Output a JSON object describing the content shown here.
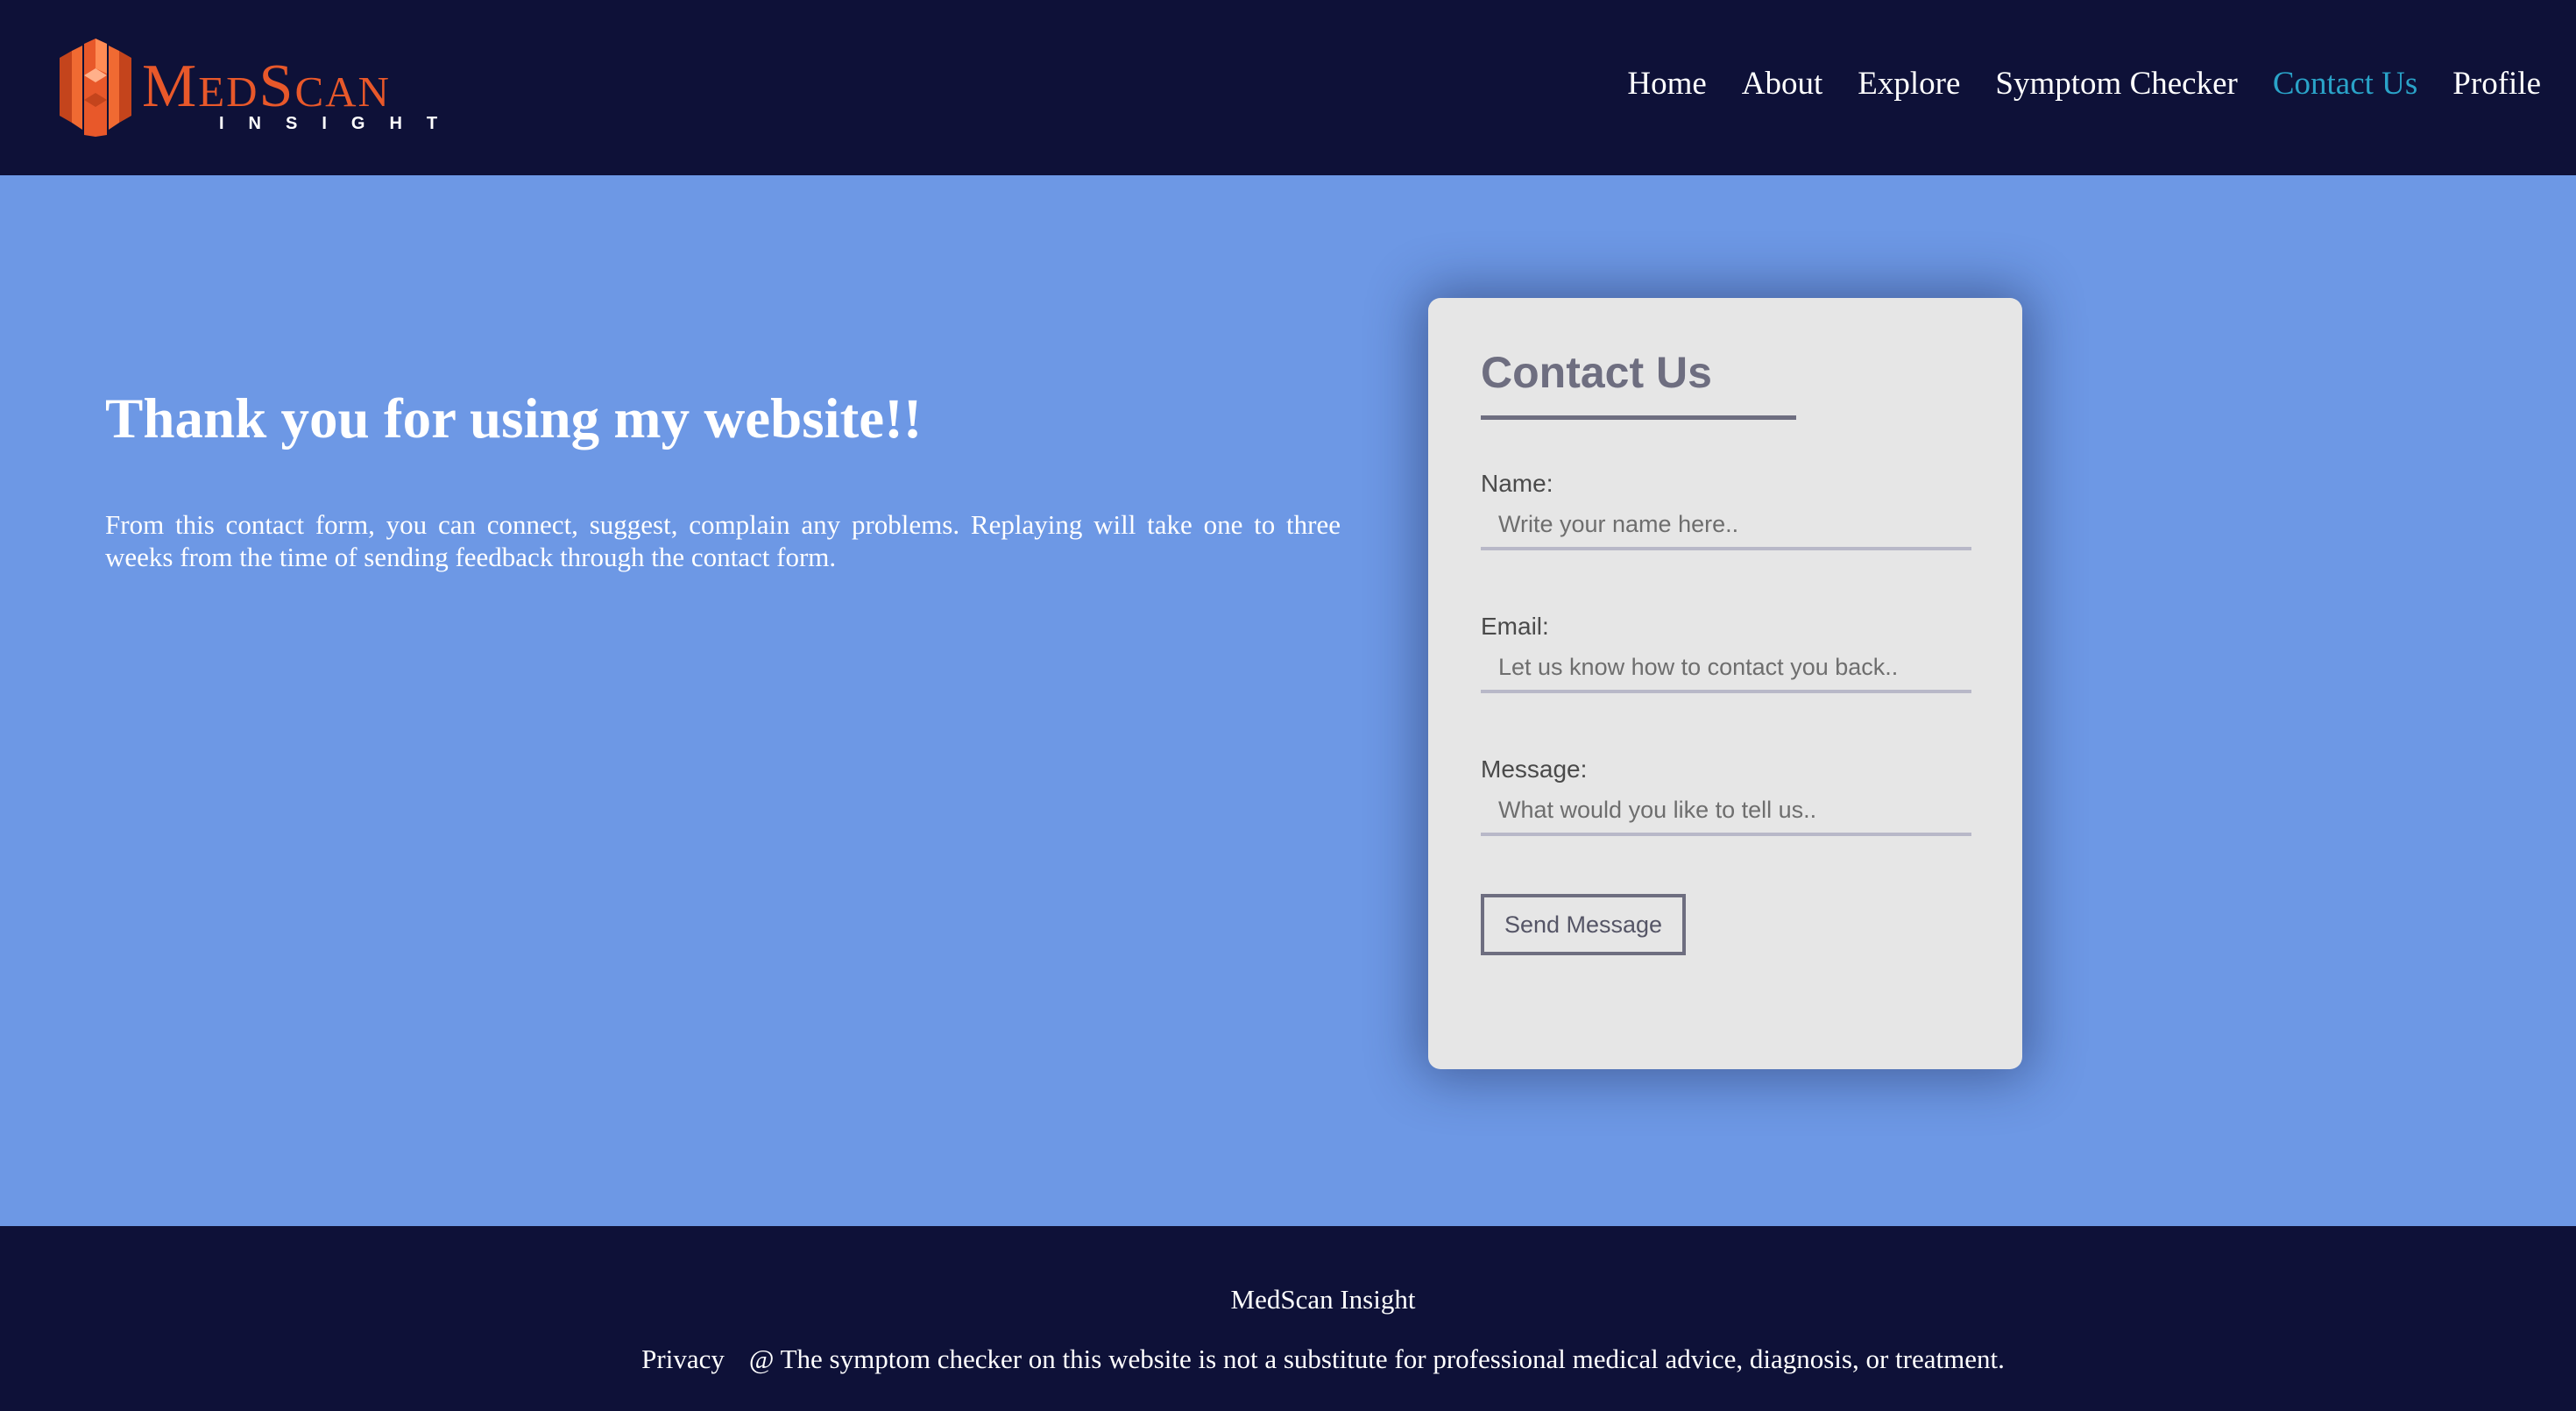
{
  "colors": {
    "header_bg": "#0e1138",
    "page_bg": "#6d98e5",
    "card_bg": "#e6e6e6",
    "logo_accent": "#e8582a",
    "nav_active": "#2aa3c8"
  },
  "logo": {
    "title": "MedScan",
    "subtitle": "INSIGHT"
  },
  "nav": {
    "items": [
      "Home",
      "About",
      "Explore",
      "Symptom Checker",
      "Contact Us",
      "Profile"
    ],
    "active": "Contact Us"
  },
  "intro": {
    "heading": "Thank you for using my website!!",
    "paragraph": "From this contact form, you can connect, suggest, complain any problems. Replaying will take one to three weeks from the time of sending feedback through the contact form."
  },
  "contact_form": {
    "title": "Contact Us",
    "name_label": "Name:",
    "name_placeholder": "Write your name here..",
    "email_label": "Email:",
    "email_placeholder": "Let us know how to contact you back..",
    "message_label": "Message:",
    "message_placeholder": "What would you like to tell us..",
    "submit_label": "Send Message"
  },
  "footer": {
    "brand": "MedScan Insight",
    "privacy": "Privacy",
    "disclaimer": "@ The symptom checker on this website is not a substitute for professional medical advice, diagnosis, or treatment."
  }
}
